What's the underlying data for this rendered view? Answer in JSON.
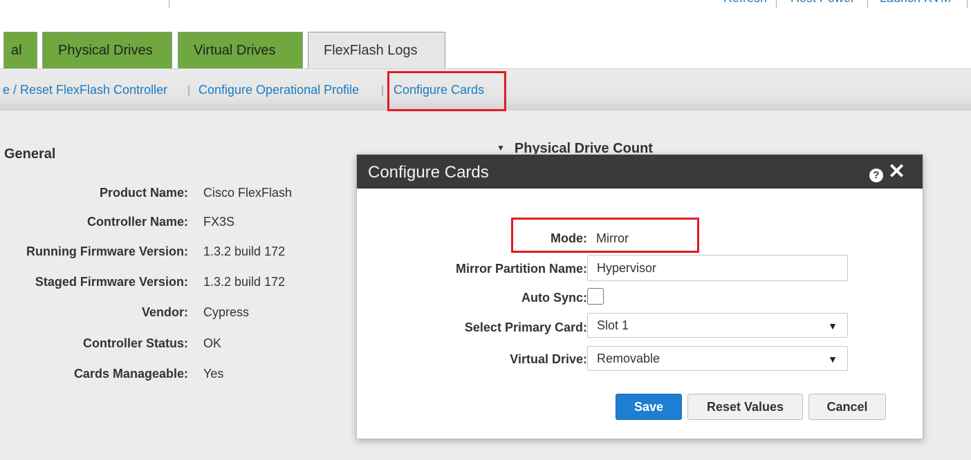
{
  "top_links": [
    "Refresh",
    "Host Power",
    "Launch KVM"
  ],
  "tabs": [
    {
      "label": "al",
      "active": false
    },
    {
      "label": "Physical Drives",
      "active": false
    },
    {
      "label": "Virtual Drives",
      "active": false
    },
    {
      "label": "FlexFlash Logs",
      "active": true
    }
  ],
  "subnav": {
    "items": [
      "e / Reset FlexFlash Controller",
      "Configure Operational Profile",
      "Configure Cards"
    ],
    "separator": "|"
  },
  "general": {
    "title": "General",
    "rows": [
      {
        "label": "Product Name:",
        "value": "Cisco FlexFlash"
      },
      {
        "label": "Controller Name:",
        "value": "FX3S"
      },
      {
        "label": "Running Firmware Version:",
        "value": "1.3.2 build 172"
      },
      {
        "label": "Staged Firmware Version:",
        "value": "1.3.2 build 172"
      },
      {
        "label": "Vendor:",
        "value": "Cypress"
      },
      {
        "label": "Controller Status:",
        "value": "OK"
      },
      {
        "label": "Cards Manageable:",
        "value": "Yes"
      }
    ]
  },
  "physical_drive_count": {
    "title": "Physical Drive Count",
    "icon": "triangle-down-icon"
  },
  "dialog": {
    "title": "Configure Cards",
    "help_glyph": "?",
    "close_glyph": "✕",
    "mode": {
      "label": "Mode:",
      "value": "Mirror"
    },
    "mirror_partition": {
      "label": "Mirror Partition Name:",
      "value": "Hypervisor"
    },
    "auto_sync": {
      "label": "Auto Sync:",
      "checked": false
    },
    "primary_card": {
      "label": "Select Primary Card:",
      "value": "Slot 1"
    },
    "virtual_drive": {
      "label": "Virtual Drive:",
      "value": "Removable"
    },
    "buttons": {
      "save": "Save",
      "reset": "Reset Values",
      "cancel": "Cancel"
    }
  },
  "colors": {
    "accent": "#1d7fd1",
    "tab_green": "#6ea83f",
    "highlight": "#e21a22",
    "link": "#1c7bc0"
  }
}
